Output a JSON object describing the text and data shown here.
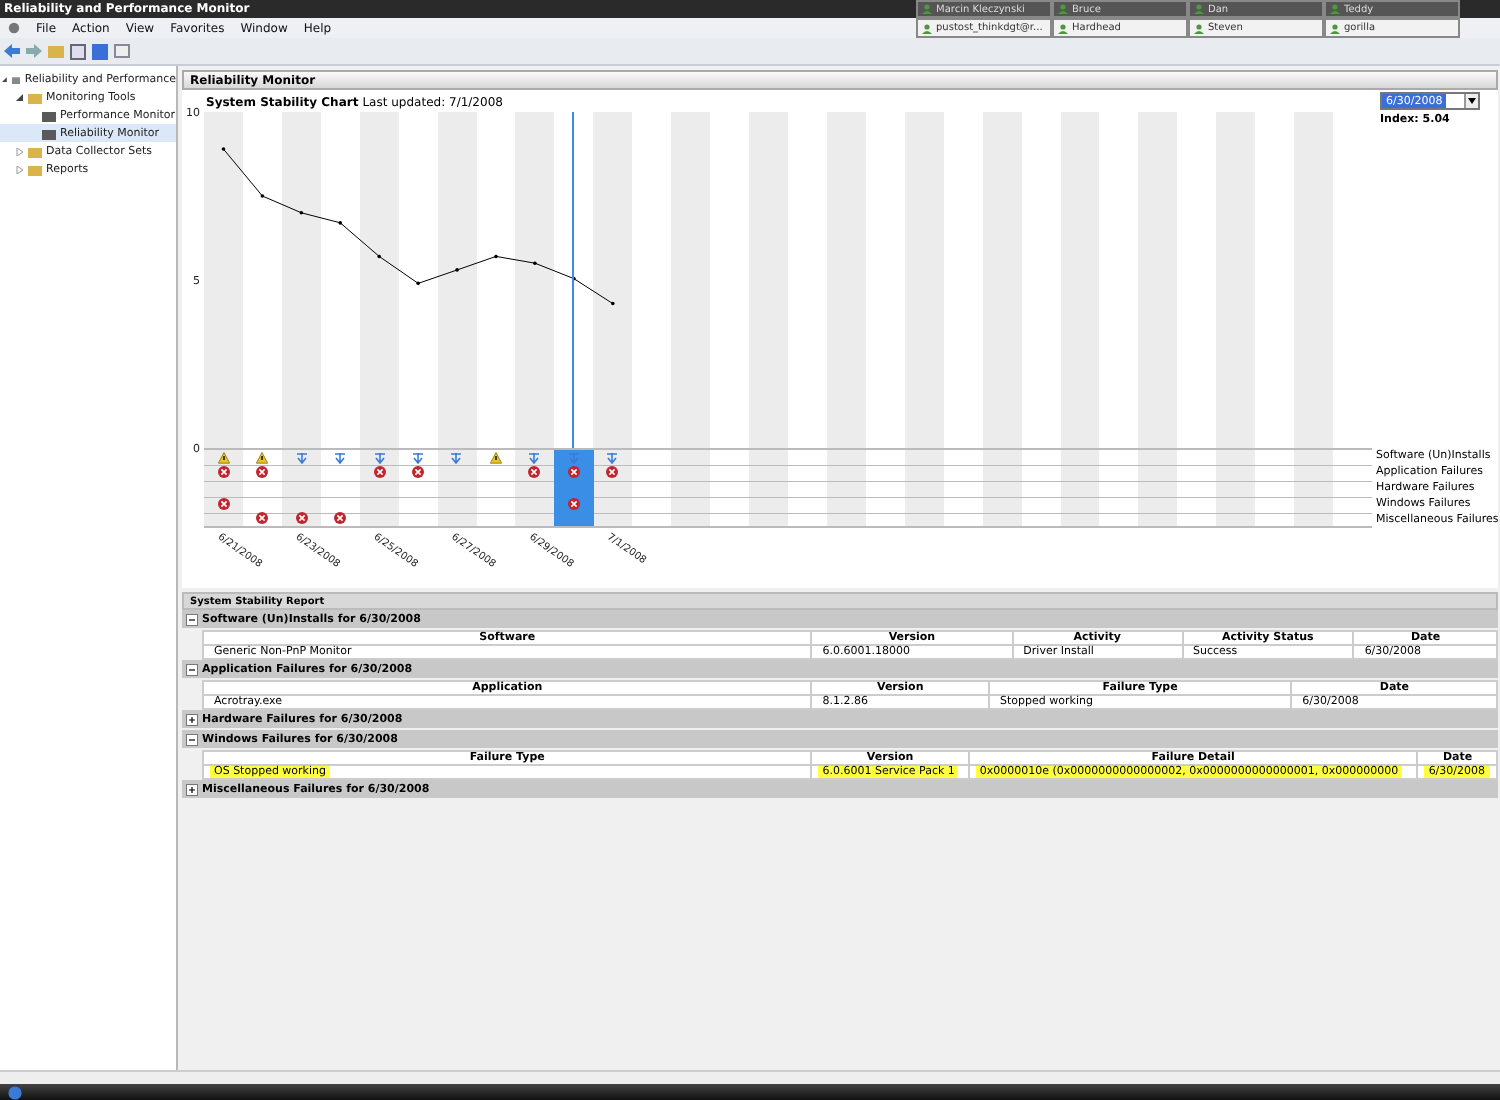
{
  "window": {
    "title": "Reliability and Performance Monitor"
  },
  "chat_tabs": {
    "row_1": [
      "Marcin Kleczynski",
      "Bruce",
      "Dan",
      "Teddy"
    ],
    "row_2": [
      "pustost_thinkdgt@r...",
      "Hardhead",
      "Steven",
      "gorilla"
    ]
  },
  "menu": [
    "File",
    "Action",
    "View",
    "Favorites",
    "Window",
    "Help"
  ],
  "sidebar": {
    "items": [
      {
        "label": "Reliability and Performance",
        "selected": false,
        "expanded": true,
        "children": [
          {
            "label": "Monitoring Tools",
            "selected": false,
            "expanded": true,
            "children": [
              {
                "label": "Performance Monitor",
                "selected": false
              },
              {
                "label": "Reliability Monitor",
                "selected": true
              }
            ]
          },
          {
            "label": "Data Collector Sets",
            "selected": false,
            "expanded": false
          },
          {
            "label": "Reports",
            "selected": false,
            "expanded": false
          }
        ]
      }
    ]
  },
  "panel": {
    "title": "Reliability Monitor",
    "chart_title": "System Stability Chart",
    "last_updated": "Last updated: 7/1/2008",
    "date_picker": {
      "value": "6/30/2008"
    },
    "index": "Index: 5.04",
    "day_columns": [
      {
        "selected": false
      },
      {
        "selected": false
      },
      {
        "selected": false
      },
      {
        "selected": false
      },
      {
        "selected": false
      },
      {
        "selected": false
      },
      {
        "selected": false
      },
      {
        "selected": false
      },
      {
        "selected": false
      },
      {
        "selected": true
      },
      {
        "selected": false
      }
    ]
  },
  "chart_data": {
    "type": "line",
    "categories": [
      "6/21/2008",
      null,
      "6/23/2008",
      null,
      "6/25/2008",
      null,
      "6/27/2008",
      null,
      "6/29/2008",
      null,
      "7/1/2008"
    ],
    "series": [
      {
        "color": "#000000",
        "values": [
          8.9,
          7.5,
          7.0,
          6.7,
          5.7,
          4.9,
          5.3,
          5.7,
          5.5,
          5.04,
          4.3
        ]
      }
    ],
    "ylim": [
      0,
      10
    ],
    "yticks": [
      {
        "value": 0,
        "label": "0"
      },
      {
        "value": 5,
        "label": "5"
      },
      {
        "value": 10,
        "label": "10"
      }
    ]
  },
  "event_rows": [
    {
      "label": "Software (Un)Installs",
      "marks": [
        {
          "kind": "warning"
        },
        {
          "kind": "warning"
        },
        {
          "kind": "info"
        },
        {
          "kind": "info"
        },
        {
          "kind": "info"
        },
        {
          "kind": "info"
        },
        {
          "kind": "info"
        },
        {
          "kind": "warning"
        },
        {
          "kind": "info"
        },
        {
          "kind": "info"
        },
        {
          "kind": "info"
        }
      ]
    },
    {
      "label": "Application Failures",
      "marks": [
        {
          "kind": "error"
        },
        {
          "kind": "error"
        },
        {
          "kind": "none"
        },
        {
          "kind": "none"
        },
        {
          "kind": "error"
        },
        {
          "kind": "error"
        },
        {
          "kind": "none"
        },
        {
          "kind": "none"
        },
        {
          "kind": "error"
        },
        {
          "kind": "error"
        },
        {
          "kind": "error"
        }
      ]
    },
    {
      "label": "Hardware Failures",
      "marks": []
    },
    {
      "label": "Windows Failures",
      "marks": [
        {
          "kind": "error"
        },
        {
          "kind": "none"
        },
        {
          "kind": "none"
        },
        {
          "kind": "none"
        },
        {
          "kind": "none"
        },
        {
          "kind": "none"
        },
        {
          "kind": "none"
        },
        {
          "kind": "none"
        },
        {
          "kind": "none"
        },
        {
          "kind": "error"
        },
        {
          "kind": "none"
        }
      ]
    },
    {
      "label": "Miscellaneous Failures",
      "marks": [
        {
          "kind": "none"
        },
        {
          "kind": "error"
        },
        {
          "kind": "error"
        },
        {
          "kind": "error"
        }
      ]
    }
  ],
  "report": {
    "title": "System Stability Report",
    "sections": [
      {
        "title": "Software (Un)Installs for 6/30/2008",
        "expanded": true,
        "columns": [
          "Software",
          "Version",
          "Activity",
          "Activity Status",
          "Date"
        ],
        "rows": [
          {
            "highlighted": false,
            "cells": [
              "Generic Non-PnP Monitor",
              "6.0.6001.18000",
              "Driver Install",
              "Success",
              "6/30/2008"
            ]
          }
        ]
      },
      {
        "title": "Application Failures for 6/30/2008",
        "expanded": true,
        "columns": [
          "Application",
          "Version",
          "Failure Type",
          "Date"
        ],
        "rows": [
          {
            "highlighted": false,
            "cells": [
              "Acrotray.exe",
              "8.1.2.86",
              "Stopped working",
              "6/30/2008"
            ]
          }
        ]
      },
      {
        "title": "Hardware Failures for 6/30/2008",
        "expanded": false
      },
      {
        "title": "Windows Failures for 6/30/2008",
        "expanded": true,
        "columns": [
          "Failure Type",
          "Version",
          "Failure Detail",
          "Date"
        ],
        "rows": [
          {
            "highlighted": true,
            "cells": [
              "OS Stopped working",
              "6.0.6001 Service Pack 1",
              "0x0000010e (0x0000000000000002, 0x0000000000000001, 0x000000000",
              "6/30/2008"
            ]
          }
        ]
      },
      {
        "title": "Miscellaneous Failures for 6/30/2008",
        "expanded": false
      }
    ]
  }
}
